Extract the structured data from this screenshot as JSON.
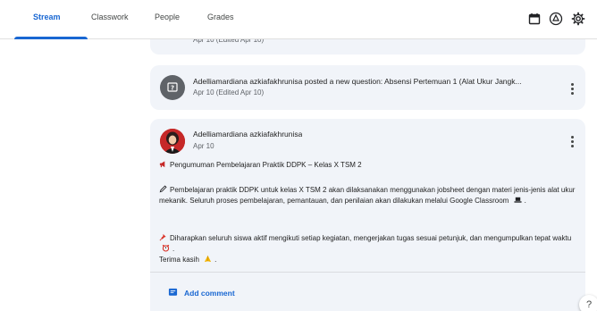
{
  "tabs": [
    {
      "label": "Stream",
      "active": true
    },
    {
      "label": "Classwork",
      "active": false
    },
    {
      "label": "People",
      "active": false
    },
    {
      "label": "Grades",
      "active": false
    }
  ],
  "toolbar_icons": [
    "calendar-icon",
    "drive-icon",
    "settings-icon"
  ],
  "previous_post": {
    "date": "Apr 10 (Edited Apr 10)"
  },
  "question_post": {
    "title": "Adelliamardiana azkiafakhrunisa posted a new question: Absensi Pertemuan 1 (Alat Ukur Jangk...",
    "date": "Apr 10 (Edited Apr 10)"
  },
  "announcement": {
    "author": "Adelliamardiana azkiafakhrunisa",
    "date": "Apr 10",
    "heading": "Pengumuman Pembelajaran Praktik DDPK – Kelas X TSM 2",
    "paragraph1": "Pembelajaran praktik DDPK untuk kelas X TSM 2 akan dilaksanakan menggunakan jobsheet dengan materi jenis-jenis alat ukur mekanik. Seluruh proses pembelajaran, pemantauan, dan penilaian akan dilakukan melalui Google Classroom",
    "paragraph2": "Diharapkan seluruh siswa aktif mengikuti setiap kegiatan, mengerjakan tugas sesuai petunjuk, dan mengumpulkan tepat waktu",
    "closing": "Terima kasih",
    "add_comment": "Add comment"
  },
  "help": "?",
  "colors": {
    "accent": "#1967d2",
    "card_bg": "#f1f4f9"
  }
}
